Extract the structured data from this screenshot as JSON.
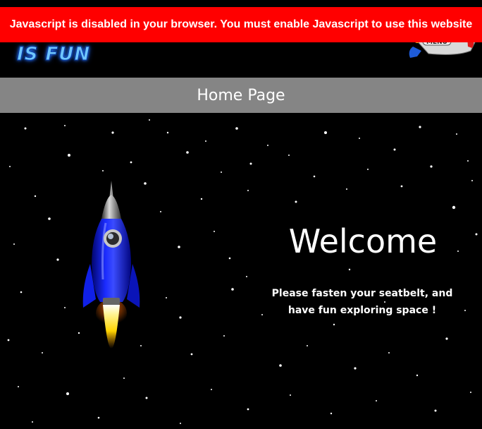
{
  "banner": {
    "text": "Javascript is disabled in your browser. You must enable Javascript to use this website"
  },
  "header": {
    "logo_text": "IS FUN",
    "menu_label": "MENU"
  },
  "page": {
    "title": "Home Page"
  },
  "hero": {
    "heading": "Welcome",
    "tagline": "Please fasten your seatbelt, and have fun exploring space !"
  },
  "colors": {
    "banner_bg": "#ff0000",
    "titlebar_bg": "#858585",
    "background": "#000000",
    "rocket_body": "#0a1ee0"
  }
}
